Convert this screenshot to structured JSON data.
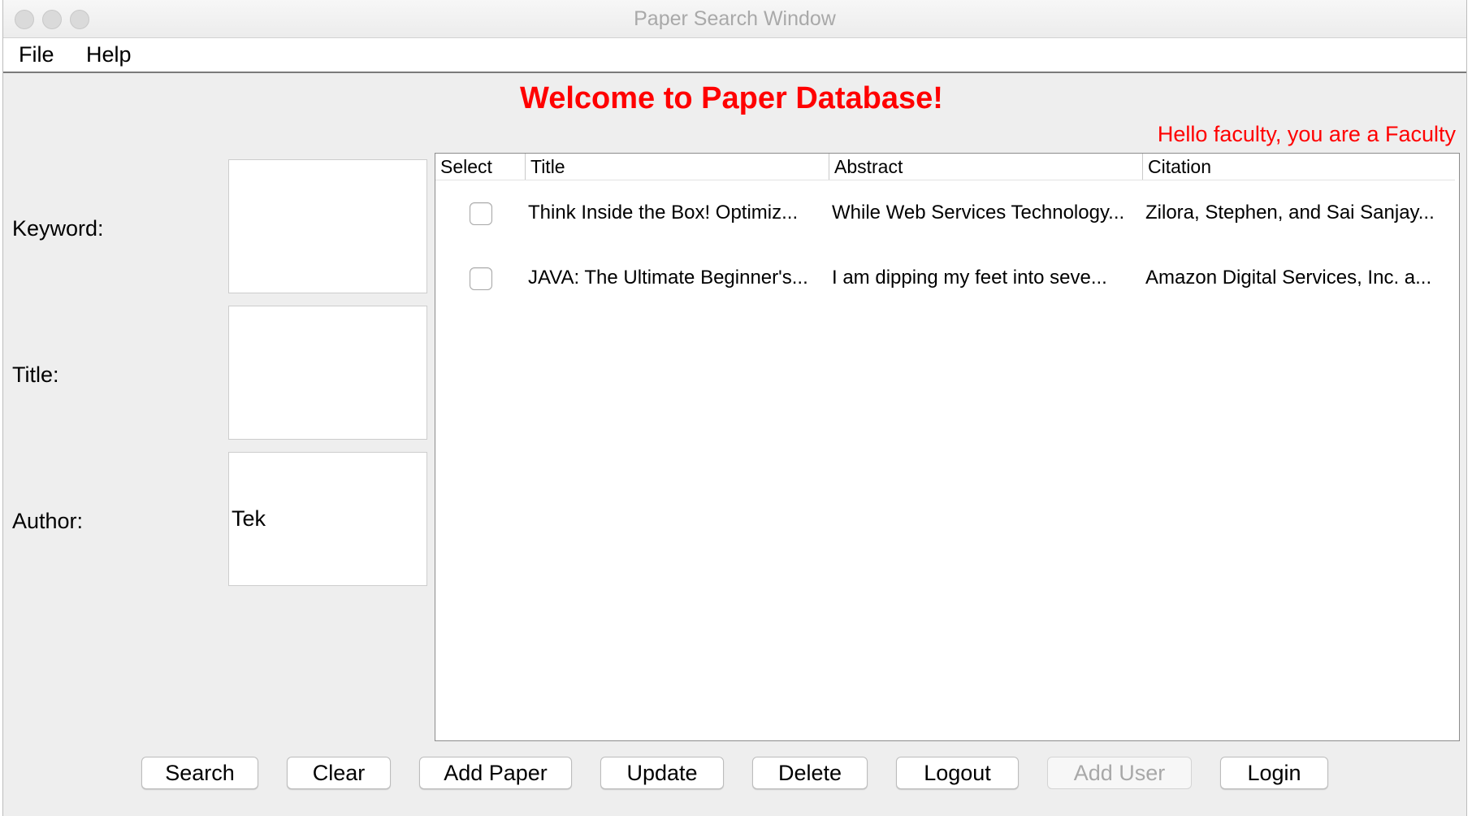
{
  "window": {
    "title": "Paper Search Window"
  },
  "menu": {
    "file": "File",
    "help": "Help"
  },
  "heading": "Welcome to Paper Database!",
  "greeting": "Hello faculty, you are a Faculty",
  "form": {
    "keyword": {
      "label": "Keyword:",
      "value": ""
    },
    "title": {
      "label": "Title:",
      "value": ""
    },
    "author": {
      "label": "Author:",
      "value": "Tek"
    }
  },
  "table": {
    "columns": [
      "Select",
      "Title",
      "Abstract",
      "Citation"
    ],
    "rows": [
      {
        "selected": false,
        "title": "Think Inside the Box! Optimiz...",
        "abstract": "While Web Services Technology...",
        "citation": "Zilora, Stephen, and Sai Sanjay..."
      },
      {
        "selected": false,
        "title": "JAVA: The Ultimate Beginner's...",
        "abstract": "I am dipping my feet into seve...",
        "citation": "Amazon Digital Services, Inc. a..."
      }
    ]
  },
  "buttons": {
    "search": "Search",
    "clear": "Clear",
    "add_paper": "Add Paper",
    "update": "Update",
    "delete": "Delete",
    "logout": "Logout",
    "add_user": "Add User",
    "login": "Login"
  },
  "colors": {
    "accent_red": "#ff0000",
    "disabled_text": "#a8a8a8"
  }
}
